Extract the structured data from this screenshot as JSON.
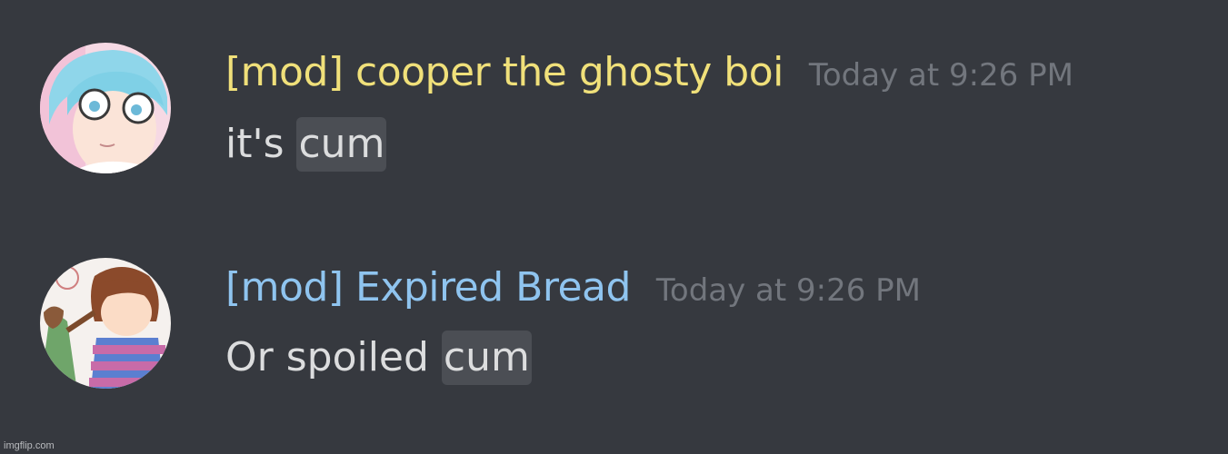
{
  "messages": [
    {
      "author": "[mod] cooper the ghosty boi",
      "author_color": "#f0e07a",
      "timestamp": "Today at 9:26 PM",
      "text_before": "it's ",
      "spoiler": "cum",
      "avatar_icon": "ghost-boy-avatar"
    },
    {
      "author": "[mod] Expired Bread",
      "author_color": "#8fc4ef",
      "timestamp": "Today at 9:26 PM",
      "text_before": "Or spoiled ",
      "spoiler": "cum",
      "avatar_icon": "expired-bread-avatar"
    }
  ],
  "watermark": "imgflip.com",
  "theme": {
    "background": "#36393f",
    "message_text": "#dcddde",
    "timestamp": "#72767d",
    "spoiler_bg": "#4b4e54"
  }
}
